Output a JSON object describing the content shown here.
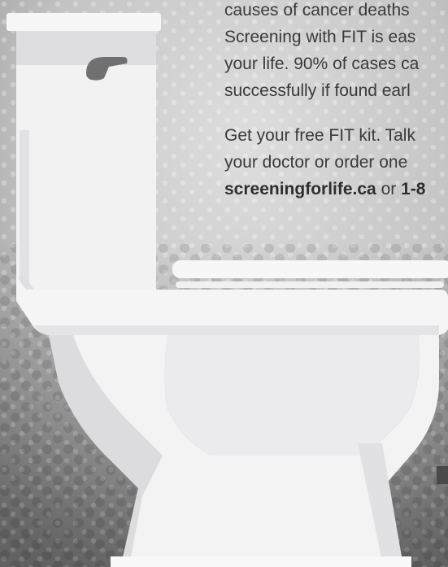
{
  "poster": {
    "paragraph_1": {
      "line_1": "causes of cancer deaths",
      "line_2": "Screening with FIT is eas",
      "line_3": "your life. 90% of cases ca",
      "line_4": "successfully if found earl"
    },
    "paragraph_2": {
      "line_1": "Get your free FIT kit. Talk",
      "line_2": "your doctor or order one",
      "link_text": "screeningforlife.ca",
      "connector": " or ",
      "phone_partial": "1-8"
    }
  },
  "colors": {
    "background_light": "#d6d6d6",
    "background_dark": "#8e8e8e",
    "dot_color": "#b9b9b9",
    "text": "#3a3a3a",
    "toilet_white": "#f4f4f5",
    "toilet_shade": "#dcdcde",
    "flush_handle": "#6f6f70"
  },
  "illustration": {
    "subject": "toilet-illustration",
    "icons": [
      "toilet-icon",
      "flush-handle-icon"
    ]
  }
}
